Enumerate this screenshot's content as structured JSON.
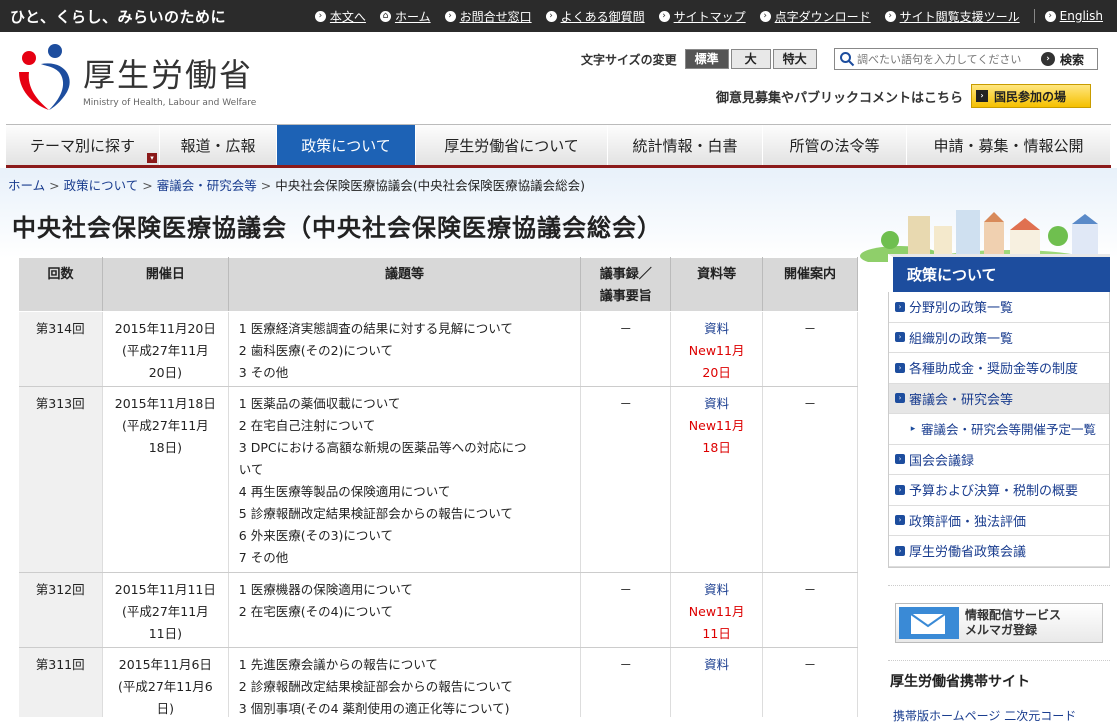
{
  "topbar": {
    "tagline": "ひと、くらし、みらいのために",
    "links": [
      "本文へ",
      "ホーム",
      "お問合せ窓口",
      "よくある御質問",
      "サイトマップ",
      "点字ダウンロード",
      "サイト閲覧支援ツール"
    ],
    "english": "English"
  },
  "header": {
    "logo_ja": "厚生労働省",
    "logo_en": "Ministry of Health, Labour and Welfare",
    "fontsize_label": "文字サイズの変更",
    "fontsize_options": [
      "標準",
      "大",
      "特大"
    ],
    "search_placeholder": "調べたい語句を入力してください",
    "search_button": "検索",
    "participate_text": "御意見募集やパブリックコメントはこちら",
    "participate_button": "国民参加の場"
  },
  "gnav": [
    "テーマ別に探す",
    "報道・広報",
    "政策について",
    "厚生労働省について",
    "統計情報・白書",
    "所管の法令等",
    "申請・募集・情報公開"
  ],
  "breadcrumb": {
    "home": "ホーム",
    "policy": "政策について",
    "councils": "審議会・研究会等",
    "current": "中央社会保険医療協議会(中央社会保険医療協議会総会)"
  },
  "page_title": "中央社会保険医療協議会（中央社会保険医療協議会総会）",
  "table": {
    "headers": {
      "no": "回数",
      "date": "開催日",
      "agenda": "議題等",
      "mins1": "議事録／",
      "mins2": "議事要旨",
      "docs": "資料等",
      "guide": "開催案内"
    },
    "rows": [
      {
        "no": "第314回",
        "date1": "2015年11月20日",
        "date2": "(平成27年11月",
        "date3": "20日)",
        "agenda": [
          "1 医療経済実態調査の結果に対する見解について",
          "2 歯科医療(その2)について",
          "3 その他"
        ],
        "mins": "－",
        "doc": "資料",
        "new": "New11月",
        "newdate": "20日",
        "guide": "－"
      },
      {
        "no": "第313回",
        "date1": "2015年11月18日",
        "date2": "(平成27年11月",
        "date3": "18日)",
        "agenda": [
          "1 医薬品の薬価収載について",
          "2 在宅自己注射について",
          "3 DPCにおける高額な新規の医薬品等への対応につ",
          "いて",
          "4 再生医療等製品の保険適用について",
          "5 診療報酬改定結果検証部会からの報告について",
          "6 外来医療(その3)について",
          "7 その他"
        ],
        "mins": "－",
        "doc": "資料",
        "new": "New11月",
        "newdate": "18日",
        "guide": "－"
      },
      {
        "no": "第312回",
        "date1": "2015年11月11日",
        "date2": "(平成27年11月",
        "date3": "11日)",
        "agenda": [
          "1 医療機器の保険適用について",
          "2 在宅医療(その4)について"
        ],
        "mins": "－",
        "doc": "資料",
        "new": "New11月",
        "newdate": "11日",
        "guide": "－"
      },
      {
        "no": "第311回",
        "date1": "2015年11月6日",
        "date2": "(平成27年11月6",
        "date3": "日)",
        "agenda": [
          "1 先進医療会議からの報告について",
          "2 診療報酬改定結果検証部会からの報告について",
          "3 個別事項(その4 薬剤使用の適正化等について)"
        ],
        "mins": "－",
        "doc": "資料",
        "new": "",
        "newdate": "",
        "guide": "－"
      }
    ]
  },
  "sidebar": {
    "title": "政策について",
    "items": [
      "分野別の政策一覧",
      "組織別の政策一覧",
      "各種助成金・奨励金等の制度",
      "審議会・研究会等",
      "審議会・研究会等開催予定一覧",
      "国会会議録",
      "予算および決算・税制の概要",
      "政策評価・独法評価",
      "厚生労働省政策会議"
    ],
    "mail_line1": "情報配信サービス",
    "mail_line2": "メルマガ登録",
    "mobile_title": "厚生労働省携帯サイト",
    "mobile_next": "携帯版ホームページ 二次元コード"
  },
  "colors": {
    "nav_active": "#1d62b5",
    "nav_border": "#8b1a1a",
    "sidebar_head": "#1d4d9e",
    "new": "#dd0000"
  }
}
